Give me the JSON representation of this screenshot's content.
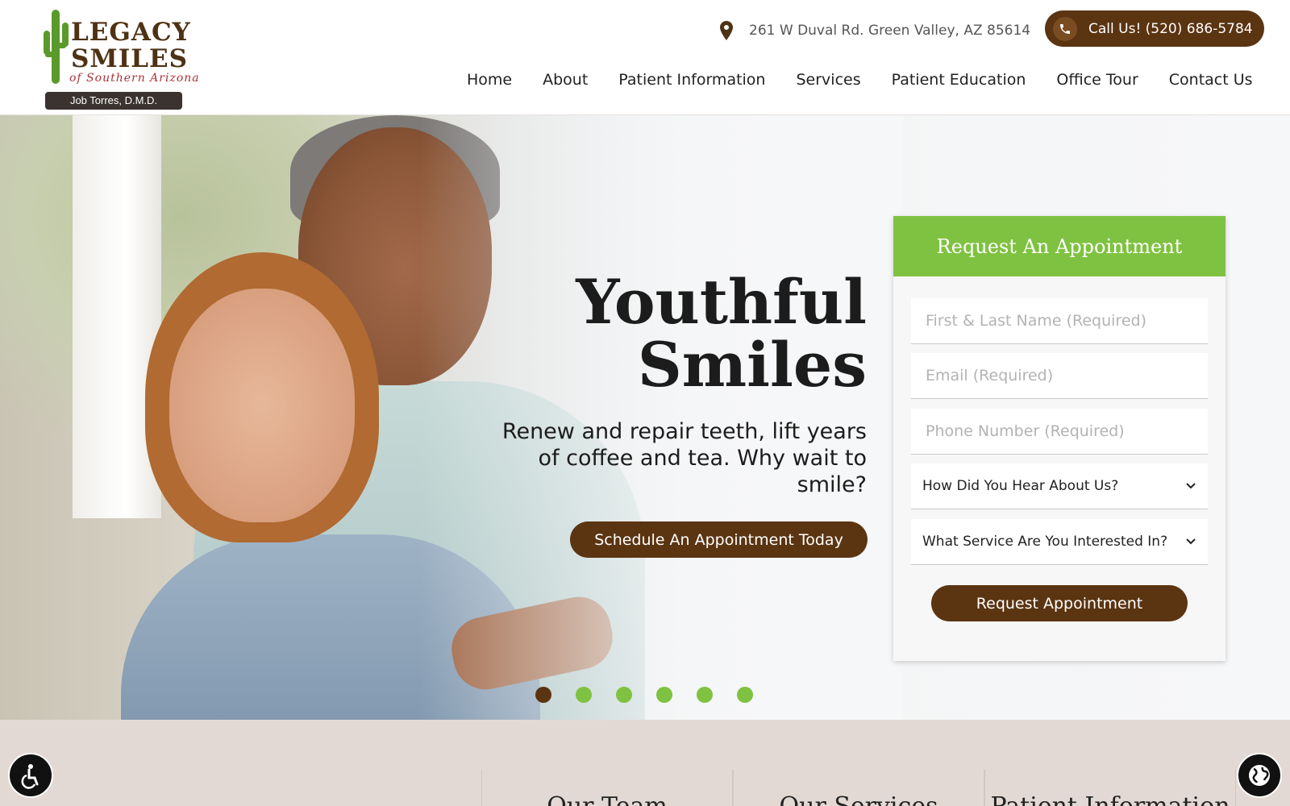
{
  "header": {
    "logo": {
      "line1": "LEGACY",
      "line2": "SMILES",
      "tagline": "of Southern Arizona",
      "doctor": "Job Torres, D.M.D."
    },
    "address": "261 W Duval Rd. Green Valley, AZ 85614",
    "call_label": "Call Us! (520) 686-5784",
    "nav": [
      "Home",
      "About",
      "Patient Information",
      "Services",
      "Patient Education",
      "Office Tour",
      "Contact Us"
    ]
  },
  "hero": {
    "title_line1": "Youthful",
    "title_line2": "Smiles",
    "subtitle": "Renew and repair teeth, lift years of coffee and tea. Why wait to smile?",
    "cta_label": "Schedule An Appointment Today",
    "slides_total": 6,
    "active_slide": 1
  },
  "form": {
    "title": "Request An Appointment",
    "name_placeholder": "First & Last Name (Required)",
    "email_placeholder": "Email (Required)",
    "phone_placeholder": "Phone Number (Required)",
    "hear_select": "How Did You Hear About Us?",
    "service_select": "What Service Are You Interested In?",
    "submit_label": "Request Appointment"
  },
  "bottom": {
    "columns": [
      "Our Team",
      "Our Services",
      "Patient Information"
    ]
  },
  "colors": {
    "brand_brown": "#5b3411",
    "brand_green": "#7fc241",
    "bottom_bg": "#e3d9d4"
  },
  "icons": [
    "location-pin-icon",
    "phone-icon",
    "chevron-down-icon",
    "accessibility-icon",
    "globe-icon"
  ]
}
